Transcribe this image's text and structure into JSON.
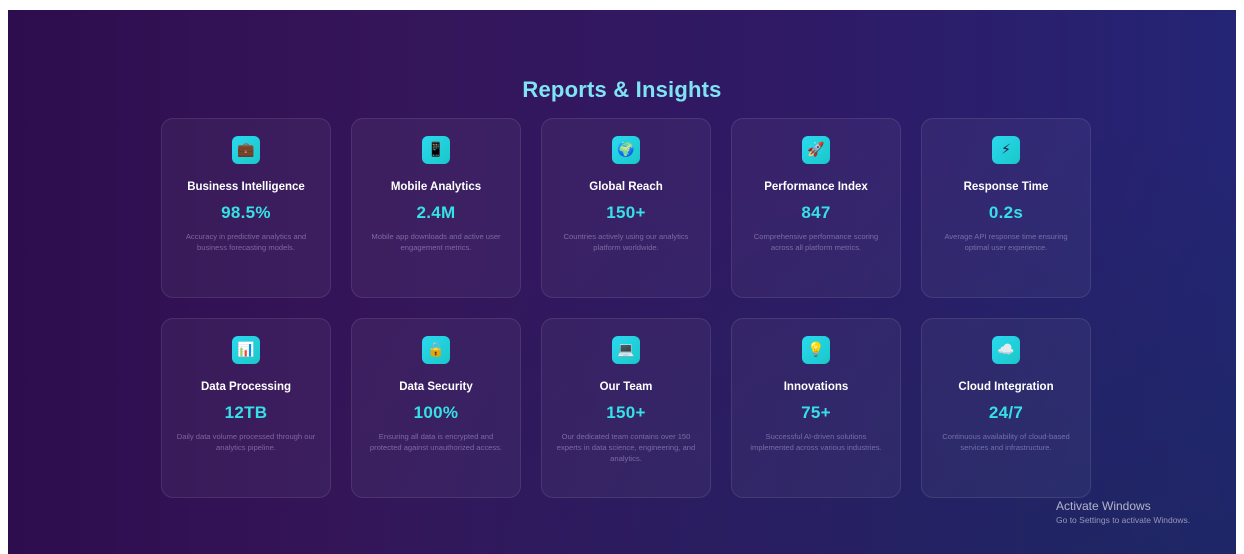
{
  "page": {
    "title": "Reports & Insights"
  },
  "cards": [
    {
      "icon": "briefcase-icon",
      "glyph": "💼",
      "title": "Business Intelligence",
      "value": "98.5%",
      "description": "Accuracy in predictive analytics and business forecasting models."
    },
    {
      "icon": "mobile-phone-icon",
      "glyph": "📱",
      "title": "Mobile Analytics",
      "value": "2.4M",
      "description": "Mobile app downloads and active user engagement metrics."
    },
    {
      "icon": "globe-icon",
      "glyph": "🌍",
      "title": "Global Reach",
      "value": "150+",
      "description": "Countries actively using our analytics platform worldwide."
    },
    {
      "icon": "rocket-icon",
      "glyph": "🚀",
      "title": "Performance Index",
      "value": "847",
      "description": "Comprehensive performance scoring across all platform metrics."
    },
    {
      "icon": "lightning-icon",
      "glyph": "⚡",
      "title": "Response Time",
      "value": "0.2s",
      "description": "Average API response time ensuring optimal user experience."
    },
    {
      "icon": "bar-chart-icon",
      "glyph": "📊",
      "title": "Data Processing",
      "value": "12TB",
      "description": "Daily data volume processed through our analytics pipeline."
    },
    {
      "icon": "lock-icon",
      "glyph": "🔒",
      "title": "Data Security",
      "value": "100%",
      "description": "Ensuring all data is encrypted and protected against unauthorized access."
    },
    {
      "icon": "laptop-icon",
      "glyph": "💻",
      "title": "Our Team",
      "value": "150+",
      "description": "Our dedicated team contains over 150 experts in data science, engineering, and analytics."
    },
    {
      "icon": "lightbulb-icon",
      "glyph": "💡",
      "title": "Innovations",
      "value": "75+",
      "description": "Successful AI-driven solutions implemented across various industries."
    },
    {
      "icon": "cloud-icon",
      "glyph": "☁️",
      "title": "Cloud Integration",
      "value": "24/7",
      "description": "Continuous availability of cloud-based services and infrastructure."
    }
  ],
  "watermark": {
    "title": "Activate Windows",
    "subtitle": "Go to Settings to activate Windows."
  },
  "colors": {
    "accent": "#35e0e6",
    "title": "#7fe3f4",
    "icon_background": "#2bd9f0"
  }
}
